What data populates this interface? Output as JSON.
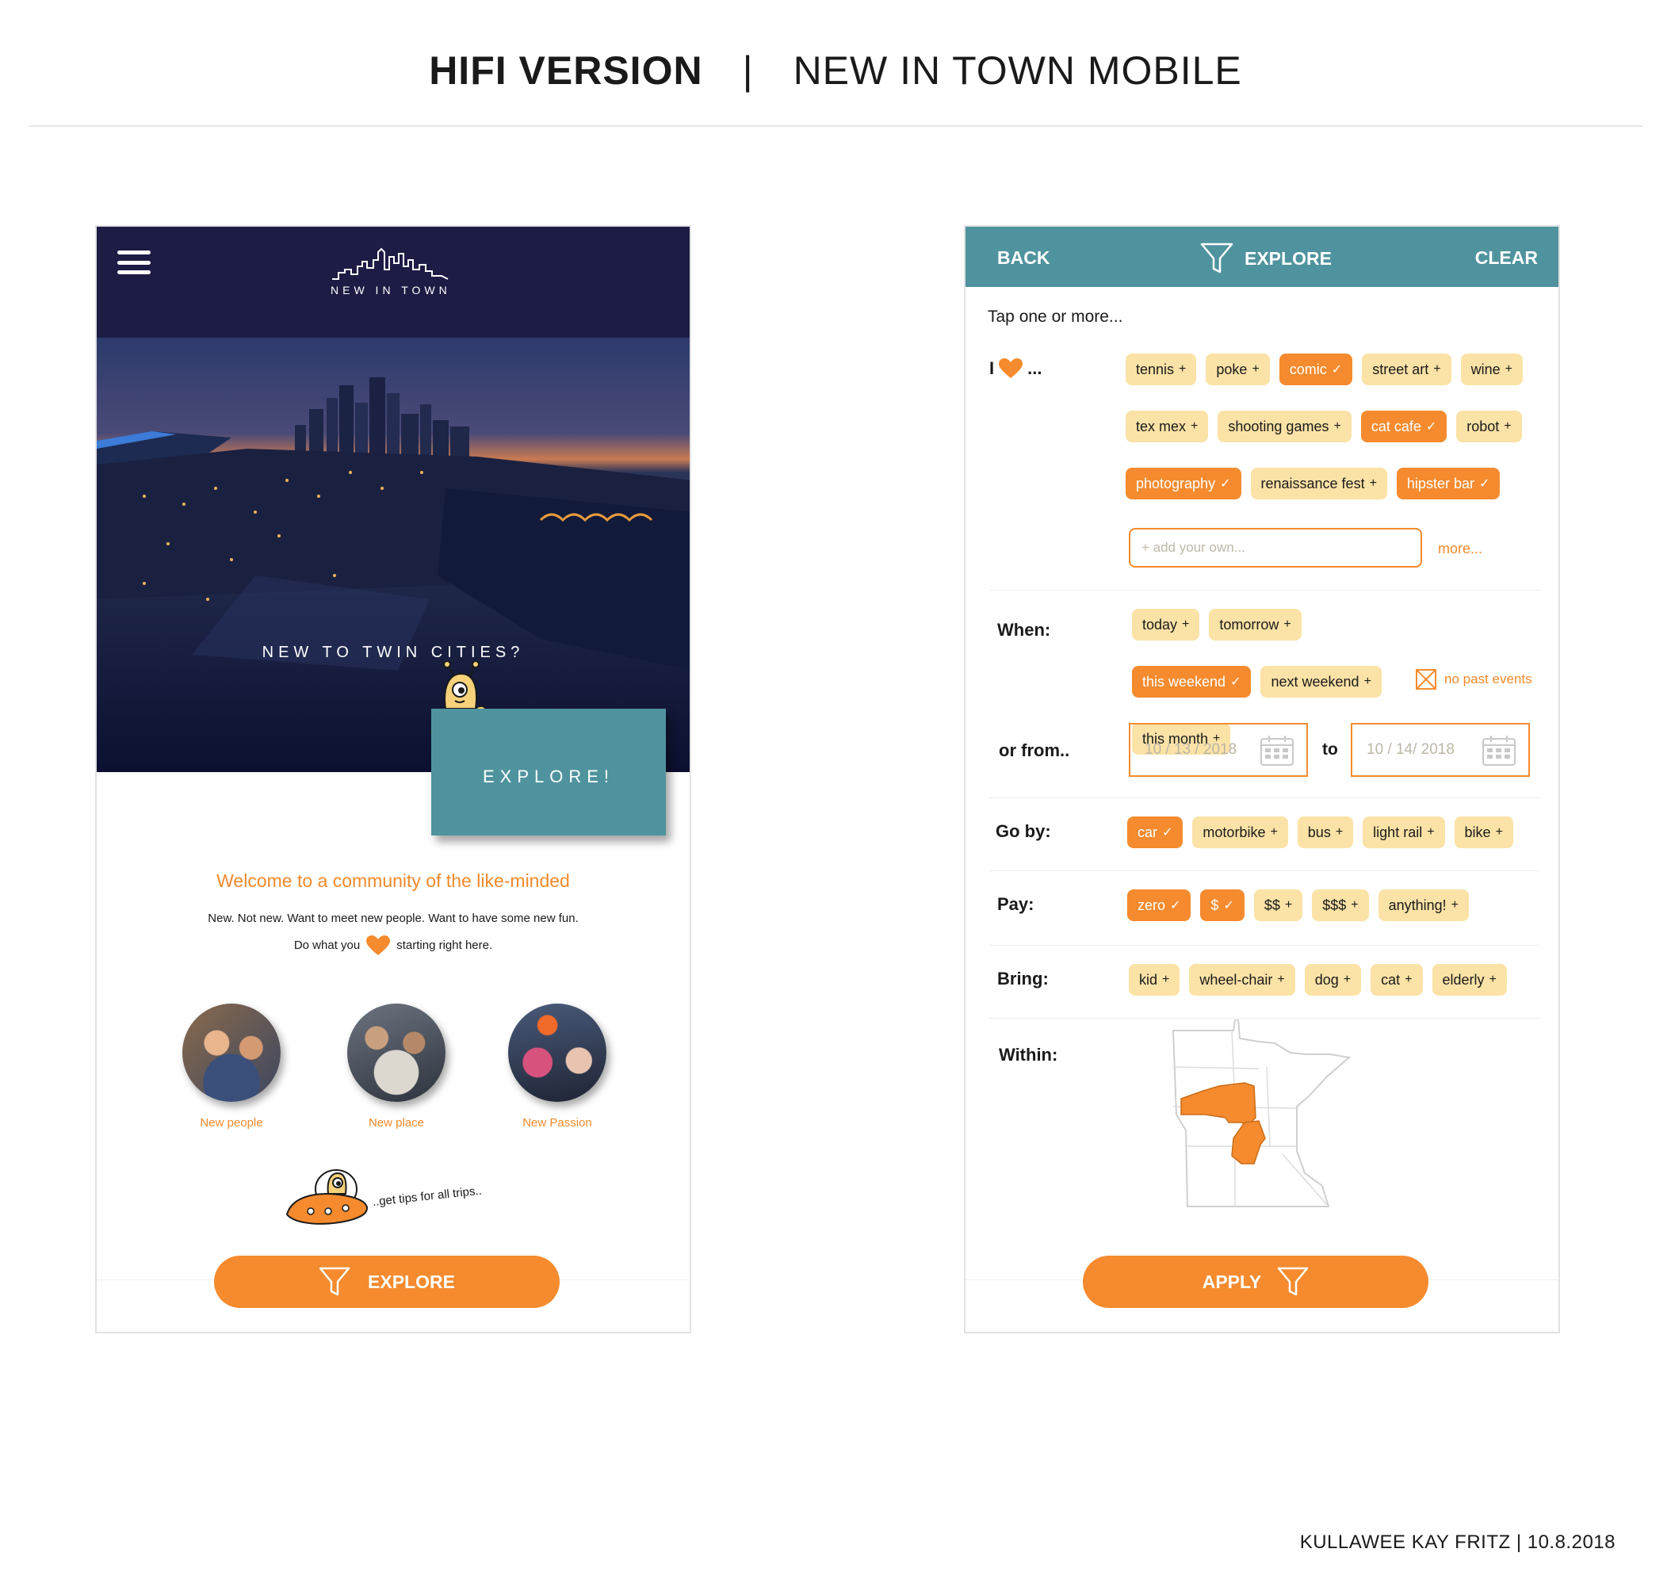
{
  "page": {
    "title_bold": "HIFI VERSION",
    "title_separator": "|",
    "title_light": "NEW IN TOWN MOBILE",
    "credit": "KULLAWEE KAY FRITZ   |   10.8.2018"
  },
  "colors": {
    "navy": "#1c1c45",
    "teal": "#4f939e",
    "orange": "#f58b2e",
    "chip_off": "#fbe2a6"
  },
  "home": {
    "menu_icon": "hamburger-menu-icon",
    "logo_text": "NEW IN TOWN",
    "hero_tagline": "NEW TO TWIN CITIES?",
    "explore_card_label": "EXPLORE!",
    "welcome_title": "Welcome to a community of the like-minded",
    "welcome_line1": "New.  Not new.  Want to meet new people.  Want to have some new fun.",
    "welcome_line2_before": "Do what you",
    "welcome_line2_after": "starting right here.",
    "circles": [
      {
        "label": "New people"
      },
      {
        "label": "New place"
      },
      {
        "label": "New Passion"
      }
    ],
    "tips_text": "..get tips for all trips..",
    "explore_button": "EXPLORE"
  },
  "filter": {
    "back": "BACK",
    "title": "EXPLORE",
    "clear": "CLEAR",
    "hint": "Tap one or more...",
    "love_label_i": "I",
    "love_label_dots": "...",
    "interests": [
      {
        "label": "tennis",
        "selected": false
      },
      {
        "label": "poke",
        "selected": false
      },
      {
        "label": "comic",
        "selected": true
      },
      {
        "label": "street art",
        "selected": false
      },
      {
        "label": "wine",
        "selected": false
      },
      {
        "label": "tex mex",
        "selected": false
      },
      {
        "label": "shooting games",
        "selected": false
      },
      {
        "label": "cat cafe",
        "selected": true
      },
      {
        "label": "robot",
        "selected": false
      },
      {
        "label": "photography",
        "selected": true
      },
      {
        "label": "renaissance fest",
        "selected": false
      },
      {
        "label": "hipster bar",
        "selected": true
      }
    ],
    "add_placeholder": "+  add your own...",
    "more": "more...",
    "when_label": "When:",
    "when": [
      {
        "label": "today",
        "selected": false
      },
      {
        "label": "tomorrow",
        "selected": false
      },
      {
        "label": "this weekend",
        "selected": true
      },
      {
        "label": "next weekend",
        "selected": false
      },
      {
        "label": "this month",
        "selected": false
      }
    ],
    "no_past_events": "no past events",
    "from_label": "or from..",
    "date_from": "10 / 13 / 2018",
    "date_to_sep": "to",
    "date_to": "10 / 14/ 2018",
    "goby_label": "Go by:",
    "goby": [
      {
        "label": "car",
        "selected": true
      },
      {
        "label": "motorbike",
        "selected": false
      },
      {
        "label": "bus",
        "selected": false
      },
      {
        "label": "light rail",
        "selected": false
      },
      {
        "label": "bike",
        "selected": false
      }
    ],
    "pay_label": "Pay:",
    "pay": [
      {
        "label": "zero",
        "selected": true
      },
      {
        "label": "$",
        "selected": true
      },
      {
        "label": "$$",
        "selected": false
      },
      {
        "label": "$$$",
        "selected": false
      },
      {
        "label": "anything!",
        "selected": false
      }
    ],
    "bring_label": "Bring:",
    "bring": [
      {
        "label": "kid",
        "selected": false
      },
      {
        "label": "wheel-chair",
        "selected": false
      },
      {
        "label": "dog",
        "selected": false
      },
      {
        "label": "cat",
        "selected": false
      },
      {
        "label": "elderly",
        "selected": false
      }
    ],
    "within_label": "Within:",
    "apply_button": "APPLY"
  }
}
